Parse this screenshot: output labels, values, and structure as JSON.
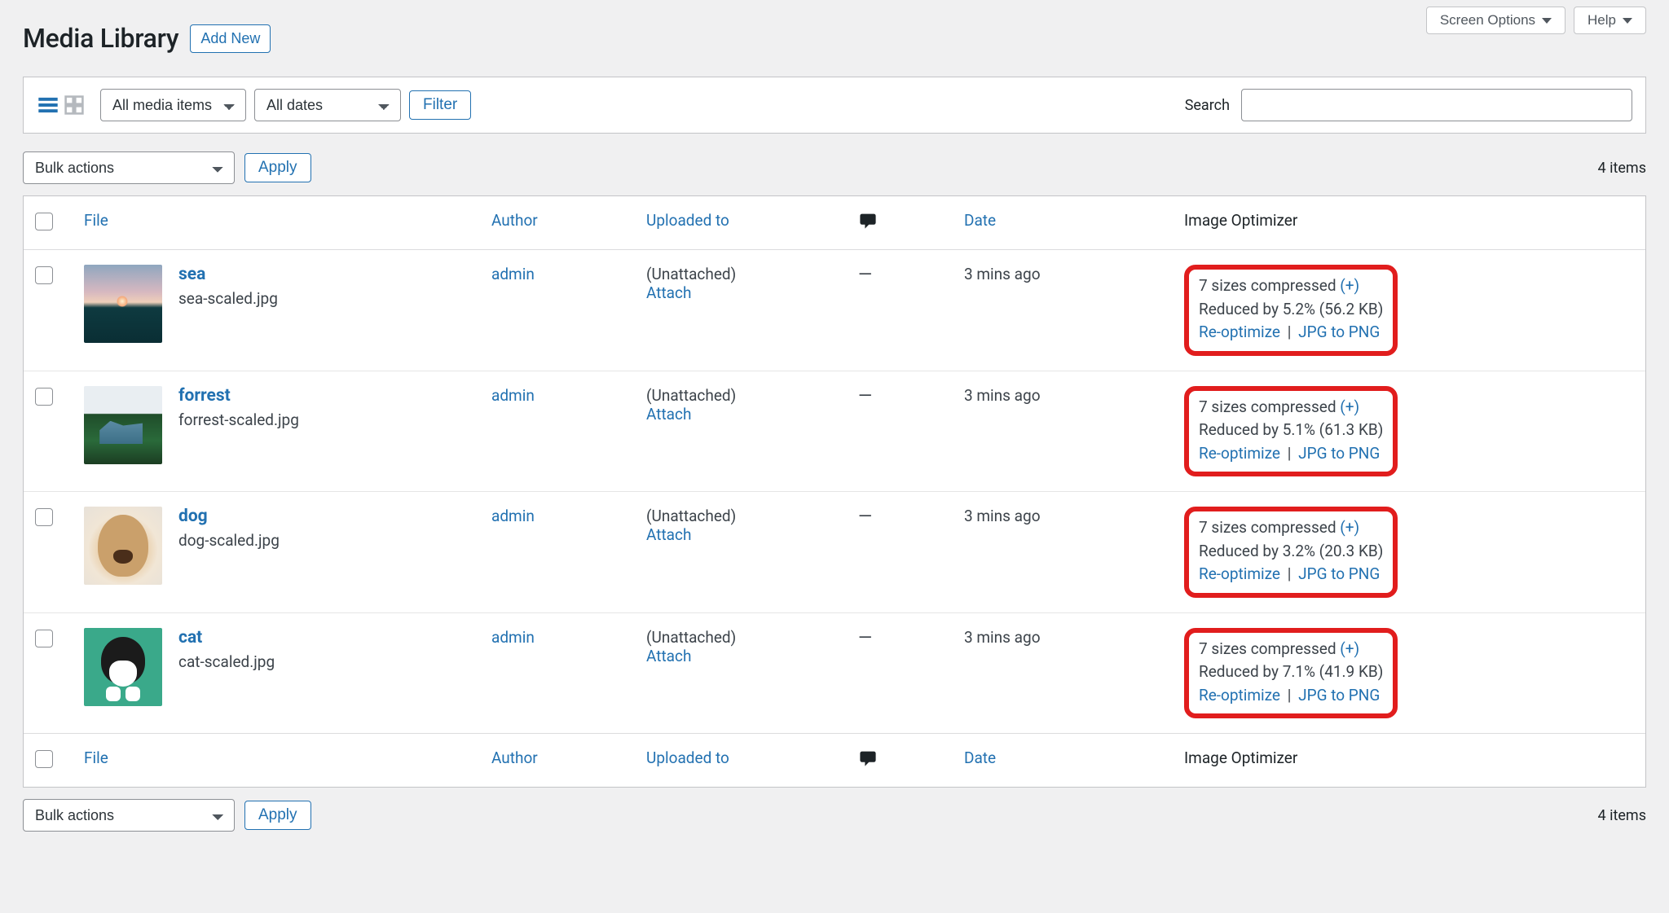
{
  "meta": {
    "screen_options": "Screen Options",
    "help": "Help"
  },
  "header": {
    "title": "Media Library",
    "add_new": "Add New"
  },
  "filters": {
    "media_type": "All media items",
    "dates": "All dates",
    "filter_btn": "Filter",
    "search_label": "Search",
    "search_value": ""
  },
  "bulk": {
    "label": "Bulk actions",
    "apply": "Apply"
  },
  "count_label": "4 items",
  "columns": {
    "file": "File",
    "author": "Author",
    "uploaded_to": "Uploaded to",
    "date": "Date",
    "image_optimizer": "Image Optimizer"
  },
  "common": {
    "unattached": "(Unattached)",
    "attach": "Attach",
    "dash": "—",
    "reoptimize": "Re-optimize",
    "sep": "|",
    "jpg_to_png": "JPG to PNG",
    "plus": "(+)"
  },
  "rows": [
    {
      "title": "sea",
      "filename": "sea-scaled.jpg",
      "author": "admin",
      "date": "3 mins ago",
      "opt_line1": "7 sizes compressed",
      "opt_line2": "Reduced by 5.2% (56.2 KB)",
      "thumb_class": "thumb-sea"
    },
    {
      "title": "forrest",
      "filename": "forrest-scaled.jpg",
      "author": "admin",
      "date": "3 mins ago",
      "opt_line1": "7 sizes compressed",
      "opt_line2": "Reduced by 5.1% (61.3 KB)",
      "thumb_class": "thumb-forrest"
    },
    {
      "title": "dog",
      "filename": "dog-scaled.jpg",
      "author": "admin",
      "date": "3 mins ago",
      "opt_line1": "7 sizes compressed",
      "opt_line2": "Reduced by 3.2% (20.3 KB)",
      "thumb_class": "thumb-dog"
    },
    {
      "title": "cat",
      "filename": "cat-scaled.jpg",
      "author": "admin",
      "date": "3 mins ago",
      "opt_line1": "7 sizes compressed",
      "opt_line2": "Reduced by 7.1% (41.9 KB)",
      "thumb_class": "thumb-cat"
    }
  ]
}
